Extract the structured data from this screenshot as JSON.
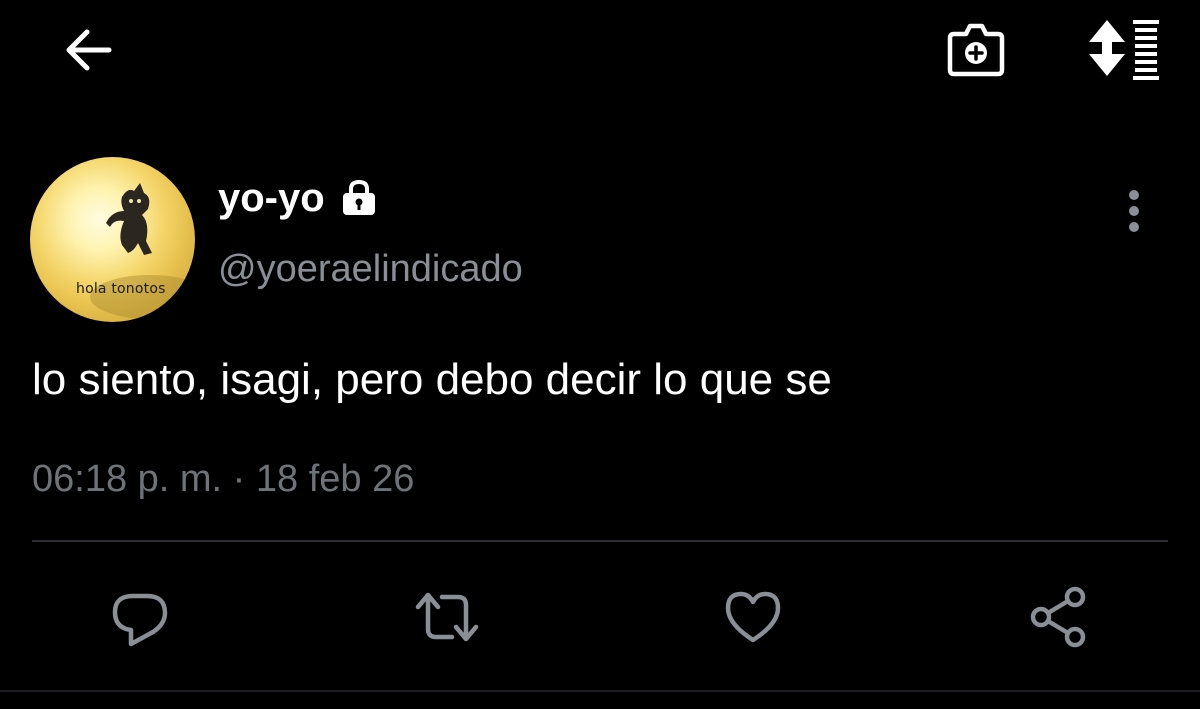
{
  "colors": {
    "background": "#000000",
    "primary_text": "#ffffff",
    "secondary_text": "#8a8f95",
    "timestamp_text": "#6e7378",
    "icon_gray": "#8a8f95",
    "divider": "#2a2d31"
  },
  "topbar": {
    "back_icon": "arrow-left-icon",
    "camera_icon": "camera-add-icon",
    "sort_icon": "sort-list-icon"
  },
  "tweet": {
    "avatar_caption": "hola tonotos",
    "display_name": "yo-yo",
    "protected_icon": "lock-icon",
    "handle": "@yoeraelindicado",
    "more_icon": "more-vertical-icon",
    "text": "lo siento, isagi, pero debo decir lo que se",
    "timestamp": "06:18 p. m. · 18 feb 26"
  },
  "actions": [
    {
      "name": "reply",
      "icon": "reply-icon"
    },
    {
      "name": "retweet",
      "icon": "retweet-icon"
    },
    {
      "name": "like",
      "icon": "heart-icon"
    },
    {
      "name": "share",
      "icon": "share-icon"
    }
  ]
}
